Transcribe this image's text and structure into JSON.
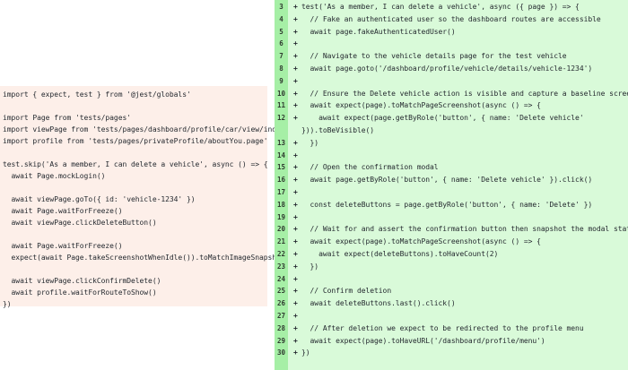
{
  "left_lines": [
    "import { expect, test } from '@jest/globals'",
    "",
    "import Page from 'tests/pages'",
    "import viewPage from 'tests/pages/dashboard/profile/car/view/index.page'",
    "import profile from 'tests/pages/privateProfile/aboutYou.page'",
    "",
    "test.skip('As a member, I can delete a vehicle', async () => {",
    "  await Page.mockLogin()",
    "",
    "  await viewPage.goTo({ id: 'vehicle-1234' })",
    "  await Page.waitForFreeze()",
    "  await viewPage.clickDeleteButton()",
    "",
    "  await Page.waitForFreeze()",
    "  expect(await Page.takeScreenshotWhenIdle()).toMatchImageSnapshot()",
    "",
    "  await viewPage.clickConfirmDelete()",
    "  await profile.waitForRouteToShow()",
    "})"
  ],
  "right_lines": [
    {
      "num": "3",
      "mark": "+",
      "code": "test('As a member, I can delete a vehicle', async ({ page }) => {"
    },
    {
      "num": "4",
      "mark": "+",
      "code": "  // Fake an authenticated user so the dashboard routes are accessible"
    },
    {
      "num": "5",
      "mark": "+",
      "code": "  await page.fakeAuthenticatedUser()"
    },
    {
      "num": "6",
      "mark": "+",
      "code": ""
    },
    {
      "num": "7",
      "mark": "+",
      "code": "  // Navigate to the vehicle details page for the test vehicle"
    },
    {
      "num": "8",
      "mark": "+",
      "code": "  await page.goto('/dashboard/profile/vehicle/details/vehicle-1234')"
    },
    {
      "num": "9",
      "mark": "+",
      "code": ""
    },
    {
      "num": "10",
      "mark": "+",
      "code": "  // Ensure the Delete vehicle action is visible and capture a baseline screenshot"
    },
    {
      "num": "11",
      "mark": "+",
      "code": "  await expect(page).toMatchPageScreenshot(async () => {"
    },
    {
      "num": "12",
      "mark": "+",
      "code": "    await expect(page.getByRole('button', { name: 'Delete vehicle'"
    },
    {
      "num": "",
      "mark": "",
      "code": "})).toBeVisible()"
    },
    {
      "num": "13",
      "mark": "+",
      "code": "  })"
    },
    {
      "num": "14",
      "mark": "+",
      "code": ""
    },
    {
      "num": "15",
      "mark": "+",
      "code": "  // Open the confirmation modal"
    },
    {
      "num": "16",
      "mark": "+",
      "code": "  await page.getByRole('button', { name: 'Delete vehicle' }).click()"
    },
    {
      "num": "17",
      "mark": "+",
      "code": ""
    },
    {
      "num": "18",
      "mark": "+",
      "code": "  const deleteButtons = page.getByRole('button', { name: 'Delete' })"
    },
    {
      "num": "19",
      "mark": "+",
      "code": ""
    },
    {
      "num": "20",
      "mark": "+",
      "code": "  // Wait for and assert the confirmation button then snapshot the modal state"
    },
    {
      "num": "21",
      "mark": "+",
      "code": "  await expect(page).toMatchPageScreenshot(async () => {"
    },
    {
      "num": "22",
      "mark": "+",
      "code": "    await expect(deleteButtons).toHaveCount(2)"
    },
    {
      "num": "23",
      "mark": "+",
      "code": "  })"
    },
    {
      "num": "24",
      "mark": "+",
      "code": ""
    },
    {
      "num": "25",
      "mark": "+",
      "code": "  // Confirm deletion"
    },
    {
      "num": "26",
      "mark": "+",
      "code": "  await deleteButtons.last().click()"
    },
    {
      "num": "27",
      "mark": "+",
      "code": ""
    },
    {
      "num": "28",
      "mark": "+",
      "code": "  // After deletion we expect to be redirected to the profile menu"
    },
    {
      "num": "29",
      "mark": "+",
      "code": "  await expect(page).toHaveURL('/dashboard/profile/menu')"
    },
    {
      "num": "30",
      "mark": "+",
      "code": "})"
    }
  ],
  "colors": {
    "removed_bg": "#fdefe9",
    "added_bg": "#d9fad9",
    "gutter_bg": "#a6efa6",
    "text": "#24292f"
  }
}
